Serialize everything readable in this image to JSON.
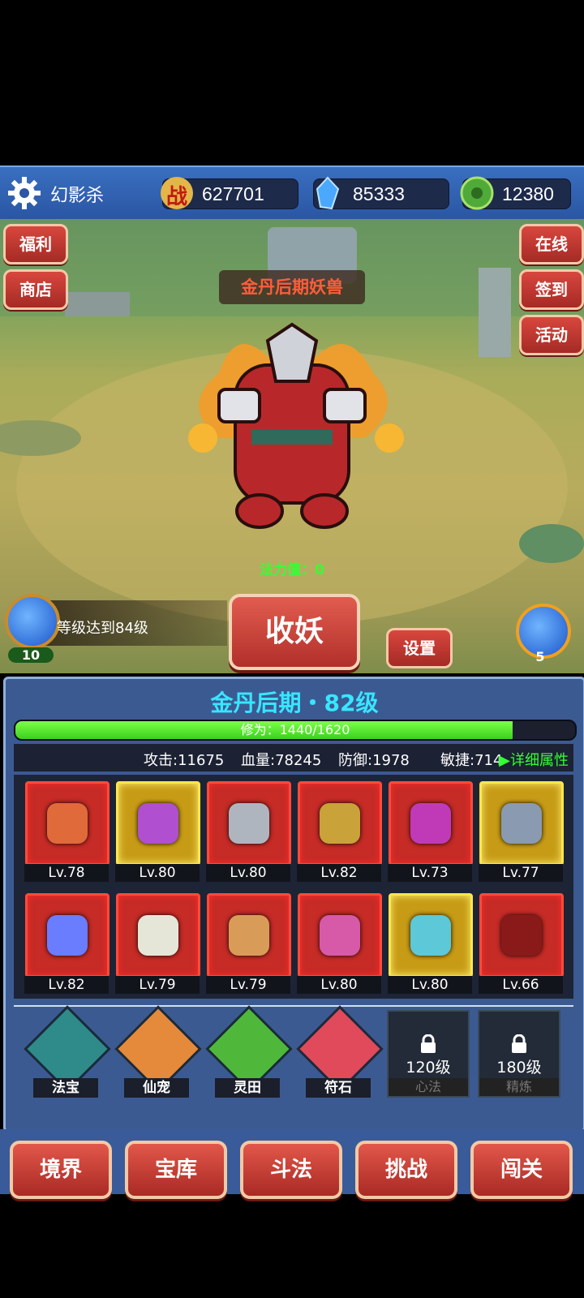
{
  "topbar": {
    "title": "幻影杀",
    "power_icon_text": "战",
    "power": "627701",
    "crystals": "85333",
    "jade": "12380"
  },
  "scene": {
    "left_tabs": [
      "福利",
      "商店"
    ],
    "right_tabs": [
      "在线",
      "签到",
      "活动"
    ],
    "boss_title": "金丹后期妖兽",
    "mana_text": "法力值：0",
    "catch_button": "收妖",
    "settings_button": "设置",
    "quest_text": "等级达到84级",
    "left_potion_count": "10",
    "right_potion_count": "5"
  },
  "panel": {
    "realm": "金丹后期・82级",
    "xp_text": "修为：1440/1620",
    "xp_fraction": 0.8889,
    "stats": {
      "attack": "攻击:11675",
      "hp": "血量:78245",
      "defense": "防御:1978",
      "agility": "敏捷:714",
      "detail": "▶详细属性"
    },
    "equipment": [
      {
        "icon": "sword-icon",
        "level": "Lv.78",
        "quality": "red"
      },
      {
        "icon": "pouch-icon",
        "level": "Lv.80",
        "quality": "gold"
      },
      {
        "icon": "gauntlet-icon",
        "level": "Lv.80",
        "quality": "red"
      },
      {
        "icon": "ring-icon",
        "level": "Lv.82",
        "quality": "red"
      },
      {
        "icon": "helmet-icon",
        "level": "Lv.73",
        "quality": "red"
      },
      {
        "icon": "armor-icon",
        "level": "Lv.77",
        "quality": "gold"
      },
      {
        "icon": "bracelet-icon",
        "level": "Lv.82",
        "quality": "red"
      },
      {
        "icon": "boots-icon",
        "level": "Lv.79",
        "quality": "red"
      },
      {
        "icon": "bracer-icon",
        "level": "Lv.79",
        "quality": "red"
      },
      {
        "icon": "wings-icon",
        "level": "Lv.80",
        "quality": "red"
      },
      {
        "icon": "pendant-icon",
        "level": "Lv.80",
        "quality": "gold"
      },
      {
        "icon": "belt-icon",
        "level": "Lv.66",
        "quality": "red"
      }
    ],
    "features": [
      {
        "label": "法宝",
        "icon": "treasure-icon"
      },
      {
        "label": "仙宠",
        "icon": "pet-icon"
      },
      {
        "label": "灵田",
        "icon": "field-icon"
      },
      {
        "label": "符石",
        "icon": "rune-icon"
      }
    ],
    "locked": [
      {
        "req": "120级",
        "name": "心法"
      },
      {
        "req": "180级",
        "name": "精炼"
      }
    ]
  },
  "nav": [
    "境界",
    "宝库",
    "斗法",
    "挑战",
    "闯关"
  ]
}
